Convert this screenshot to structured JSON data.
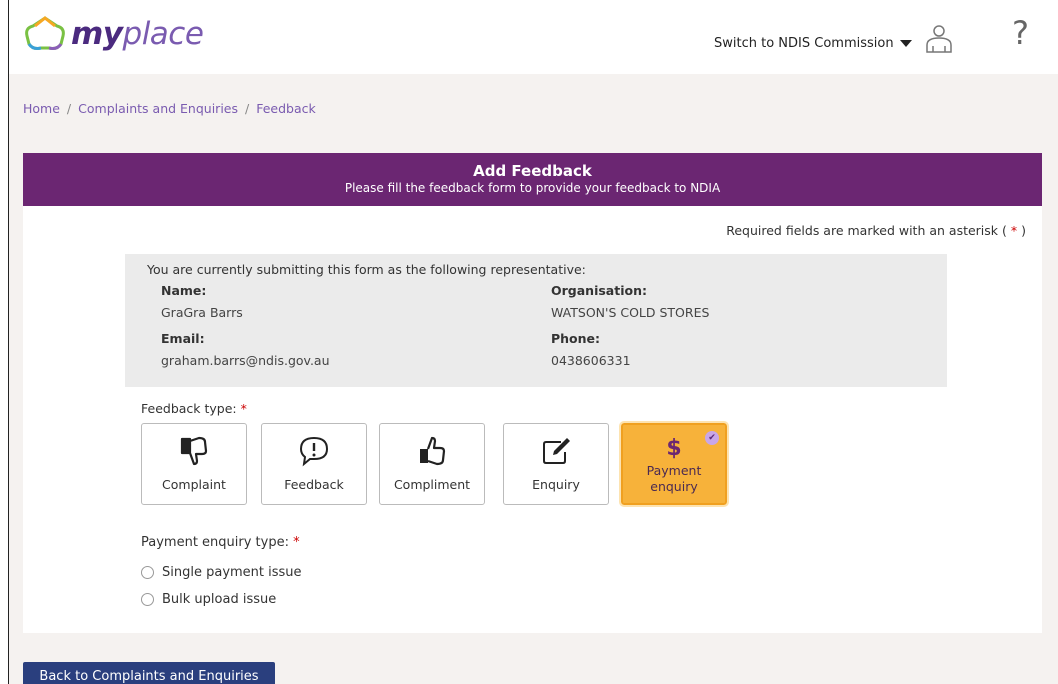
{
  "header": {
    "logo_my": "my",
    "logo_place": "place",
    "switch_label": "Switch to NDIS Commission",
    "help_glyph": "?"
  },
  "breadcrumb": {
    "home": "Home",
    "section": "Complaints and Enquiries",
    "current": "Feedback",
    "separator": "/"
  },
  "card": {
    "title": "Add Feedback",
    "subtitle": "Please fill the feedback form to provide your feedback to NDIA",
    "required_note_prefix": "Required fields are marked with an asterisk (",
    "required_note_star": "*",
    "required_note_suffix": ")"
  },
  "representative": {
    "intro": "You are currently submitting this form as the following representative:",
    "name_label": "Name:",
    "name_value": "GraGra Barrs",
    "org_label": "Organisation:",
    "org_value": "WATSON'S COLD STORES",
    "email_label": "Email:",
    "email_value": "graham.barrs@ndis.gov.au",
    "phone_label": "Phone:",
    "phone_value": "0438606331"
  },
  "feedback_type": {
    "label": "Feedback type:",
    "star": "*",
    "options": [
      {
        "label": "Complaint",
        "icon": "thumbs-down-icon"
      },
      {
        "label": "Feedback",
        "icon": "speech-exclamation-icon"
      },
      {
        "label": "Compliment",
        "icon": "thumbs-up-icon"
      },
      {
        "label": "Enquiry",
        "icon": "edit-icon"
      },
      {
        "label": "Payment enquiry",
        "icon": "dollar-icon",
        "selected": true
      }
    ],
    "payment_line1": "Payment",
    "payment_line2": "enquiry",
    "dollar_glyph": "$",
    "check_glyph": "✔"
  },
  "payment_enquiry_type": {
    "label": "Payment enquiry type:",
    "star": "*",
    "options": [
      "Single payment issue",
      "Bulk upload issue"
    ]
  },
  "back_button": "Back to Complaints and Enquiries",
  "colors": {
    "header_band": "#6b2672",
    "selected_tile": "#f7b23a",
    "back_button": "#2a3f7e",
    "link": "#7a5bb0"
  }
}
